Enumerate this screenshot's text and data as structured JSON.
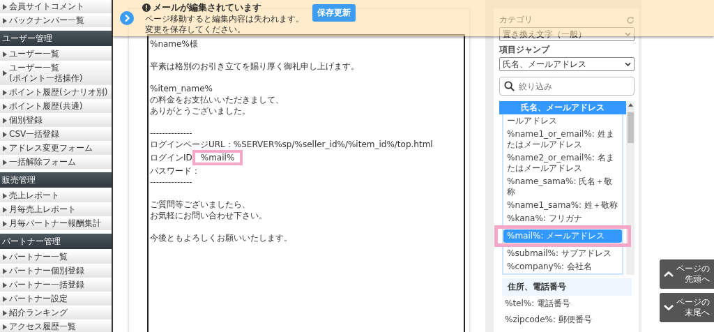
{
  "sidebar": {
    "groups": [
      {
        "items": [
          "会員サイトコメント",
          "バックナンバー一覧"
        ]
      },
      {
        "title": "ユーザー管理",
        "items": [
          "ユーザー一覧",
          "ユーザー一覧\n(ポイント一括操作)",
          "ポイント履歴(シナリオ別)",
          "ポイント履歴(共通)",
          "個別登録",
          "CSV一括登録",
          "アドレス変更フォーム",
          "一括解除フォーム"
        ]
      },
      {
        "title": "販売管理",
        "items": [
          "売上レポート",
          "月毎売上レポート",
          "月毎パートナー報酬集計"
        ]
      },
      {
        "title": "パートナー管理",
        "items": [
          "パートナー一覧",
          "パートナー個別登録",
          "パートナー一括登録",
          "パートナー設定",
          "紹介ランキング",
          "アクセス履歴一覧"
        ]
      }
    ]
  },
  "banner": {
    "title": "メールが編集されています",
    "message": [
      "ページ移動すると編集内容は失われます。",
      "変更を保存してください。"
    ],
    "button": "保存更新"
  },
  "editor": {
    "lines": [
      {
        "kind": "text",
        "text": "%name%様"
      },
      {
        "kind": "blank"
      },
      {
        "kind": "text",
        "text": "平素は格別のお引き立てを賜り厚く御礼申し上げます。"
      },
      {
        "kind": "blank"
      },
      {
        "kind": "text",
        "text": "%item_name%"
      },
      {
        "kind": "text",
        "text": "の料金をお支払いいただきまして、"
      },
      {
        "kind": "text",
        "text": "ありがとうございました。"
      },
      {
        "kind": "blank"
      },
      {
        "kind": "text",
        "text": "--------------"
      },
      {
        "kind": "text",
        "text": "ログインページURL：%SERVER%sp/%seller_id%/%item_id%/top.html"
      },
      {
        "kind": "highlight",
        "text": "ログインID",
        "mark": "%mail%"
      },
      {
        "kind": "text",
        "text": "パスワード："
      },
      {
        "kind": "text",
        "text": "--------------"
      },
      {
        "kind": "blank"
      },
      {
        "kind": "text",
        "text": "ご質問等ございましたら、"
      },
      {
        "kind": "text",
        "text": "お気軽にお問い合わせ下さい。"
      },
      {
        "kind": "blank"
      },
      {
        "kind": "text",
        "text": "今後ともよろしくお願いいたします。"
      }
    ]
  },
  "panel": {
    "category_label": "カテゴリ",
    "category_value": "置き換え文字（一般）",
    "jump_label": "項目ジャンプ",
    "jump_value": "氏名、メールアドレス",
    "search": {
      "placeholder": "絞り込み"
    },
    "list_header": "氏名、メールアドレス",
    "list_items": [
      {
        "text": "ールアドレス",
        "selected": false,
        "highlighted": false
      },
      {
        "text": "%name1_or_email%: 姓またはメールアドレス",
        "selected": false,
        "highlighted": false
      },
      {
        "text": "%name2_or_email%: 名またはメールアドレス",
        "selected": false,
        "highlighted": false
      },
      {
        "text": "%name_sama%: 氏名＋敬称",
        "selected": false,
        "highlighted": false
      },
      {
        "text": "%name1_sama%: 姓＋敬称",
        "selected": false,
        "highlighted": false
      },
      {
        "text": "%kana%: フリガナ",
        "selected": false,
        "highlighted": false
      },
      {
        "text": "%mail%: メールアドレス",
        "selected": true,
        "highlighted": true
      },
      {
        "text": "%submail%: サブアドレス",
        "selected": false,
        "highlighted": false
      },
      {
        "text": "%company%: 会社名",
        "selected": false,
        "highlighted": false
      }
    ],
    "section": "住所、電話番号",
    "section_items": [
      "%tel%: 電話番号",
      "%zipcode%: 郵便番号"
    ]
  },
  "page_nav": [
    {
      "kind": "up",
      "lines": [
        "ページの",
        "先頭へ"
      ]
    },
    {
      "kind": "down",
      "lines": [
        "ページの",
        "末尾へ"
      ]
    }
  ]
}
